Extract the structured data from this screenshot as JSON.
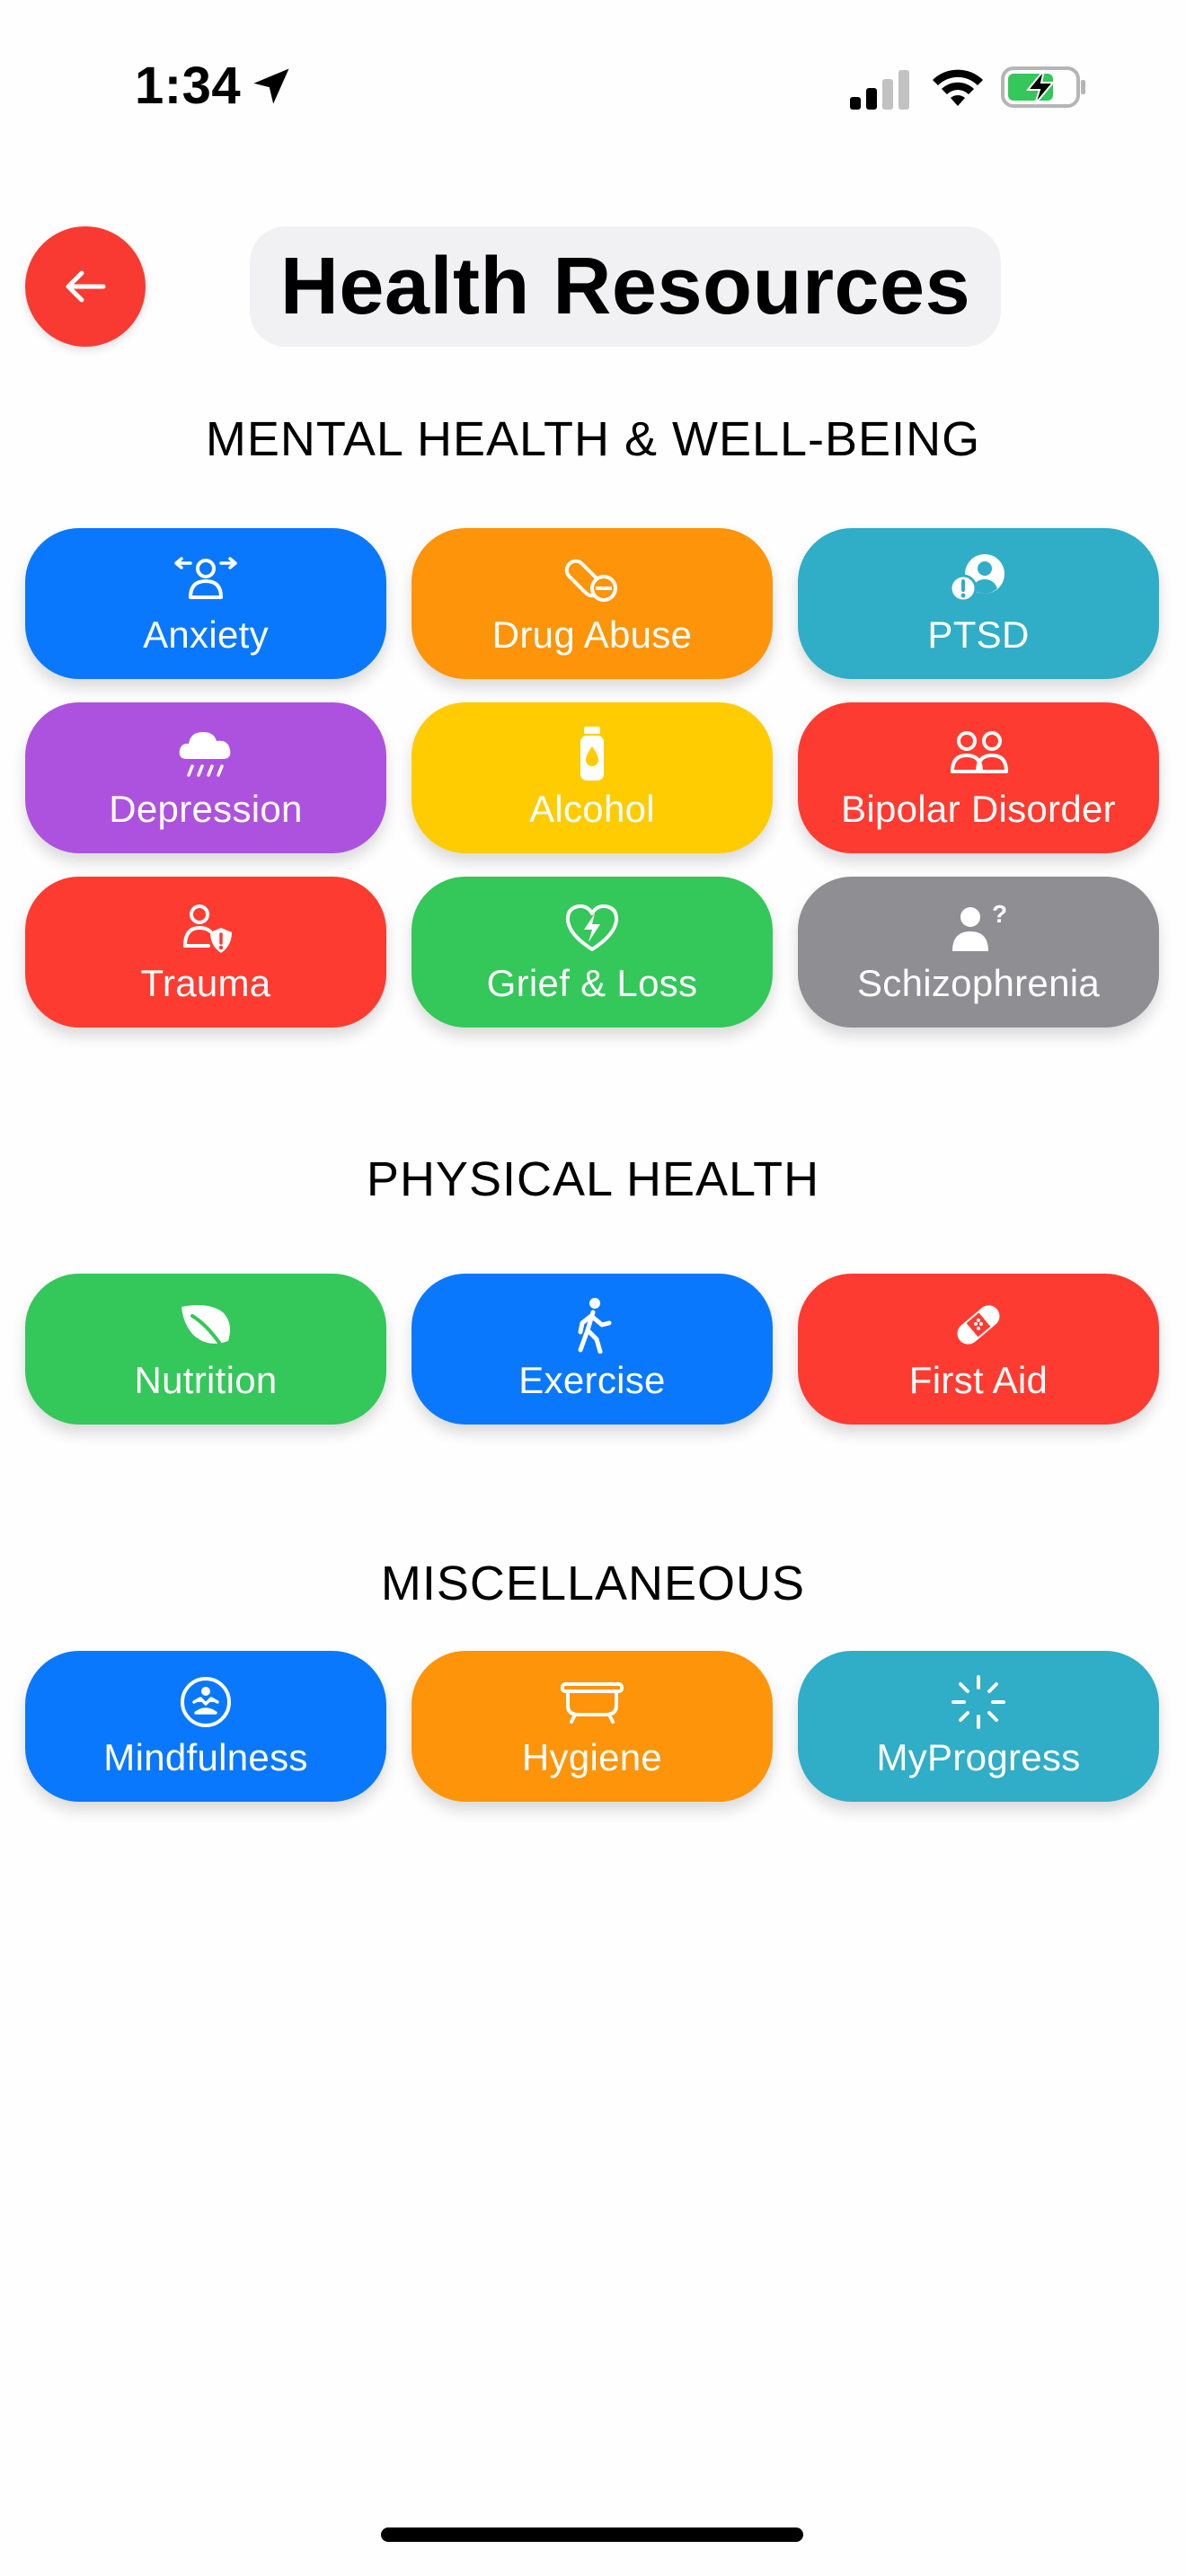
{
  "status_bar": {
    "time": "1:34",
    "icons": [
      "location-arrow-icon",
      "cellular-signal-icon",
      "wifi-icon",
      "battery-charging-icon"
    ]
  },
  "header": {
    "back_icon": "arrow-left-icon",
    "title": "Health Resources",
    "back_color": "#f83a32"
  },
  "sections": [
    {
      "heading": "MENTAL HEALTH & WELL-BEING",
      "tiles": [
        {
          "label": "Anxiety",
          "icon": "person-arrows-icon",
          "color": "#0a78fd"
        },
        {
          "label": "Drug Abuse",
          "icon": "pills-icon",
          "color": "#fe9409"
        },
        {
          "label": "PTSD",
          "icon": "person-alert-icon",
          "color": "#30adc7"
        },
        {
          "label": "Depression",
          "icon": "cloud-rain-icon",
          "color": "#ad52de"
        },
        {
          "label": "Alcohol",
          "icon": "bottle-icon",
          "color": "#fecc00"
        },
        {
          "label": "Bipolar Disorder",
          "icon": "two-people-icon",
          "color": "#fe3b30"
        },
        {
          "label": "Trauma",
          "icon": "person-shield-icon",
          "color": "#fe3b30"
        },
        {
          "label": "Grief & Loss",
          "icon": "heart-bolt-icon",
          "color": "#34c759"
        },
        {
          "label": "Schizophrenia",
          "icon": "person-question-icon",
          "color": "#8e8e93"
        }
      ]
    },
    {
      "heading": "PHYSICAL HEALTH",
      "tiles": [
        {
          "label": "Nutrition",
          "icon": "leaf-icon",
          "color": "#34c759"
        },
        {
          "label": "Exercise",
          "icon": "walking-person-icon",
          "color": "#0a78fd"
        },
        {
          "label": "First Aid",
          "icon": "bandage-icon",
          "color": "#fe3b30"
        }
      ]
    },
    {
      "heading": "MISCELLANEOUS",
      "tiles": [
        {
          "label": "Mindfulness",
          "icon": "meditation-icon",
          "color": "#0a78fd"
        },
        {
          "label": "Hygiene",
          "icon": "bathtub-icon",
          "color": "#fe9409"
        },
        {
          "label": "MyProgress",
          "icon": "progress-spinner-icon",
          "color": "#30adc7"
        }
      ]
    }
  ]
}
